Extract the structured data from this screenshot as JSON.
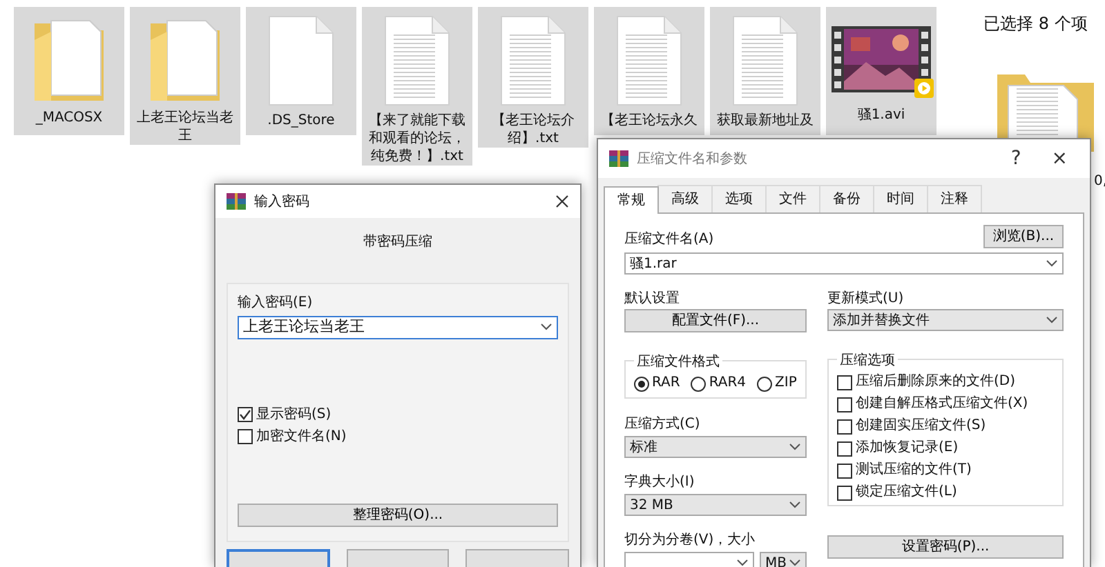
{
  "explorer": {
    "files": [
      {
        "name": "_MACOSX",
        "kind": "folder",
        "selected": true
      },
      {
        "name": "上老王论坛当老王",
        "kind": "folder",
        "selected": true
      },
      {
        "name": ".DS_Store",
        "kind": "blank",
        "selected": true
      },
      {
        "name": "【来了就能下载和观看的论坛，纯免费！】.txt",
        "kind": "text",
        "selected": true
      },
      {
        "name": "【老王论坛介绍】.txt",
        "kind": "text",
        "selected": true
      },
      {
        "name": "【老王论坛永久",
        "kind": "text",
        "selected": true
      },
      {
        "name": "获取最新地址及",
        "kind": "text",
        "selected": true
      },
      {
        "name": "骚1.avi",
        "kind": "video",
        "selected": true
      }
    ],
    "selection_status": "已选择 8 个项",
    "edge_text": "0,"
  },
  "password_dialog": {
    "title": "输入密码",
    "heading": "带密码压缩",
    "password_label": "输入密码(E)",
    "password_value": "上老王论坛当老王",
    "options": [
      {
        "label": "显示密码(S)",
        "checked": true
      },
      {
        "label": "加密文件名(N)",
        "checked": false
      }
    ],
    "organize_button": "整理密码(O)..."
  },
  "archive_dialog": {
    "title": "压缩文件名和参数",
    "help": "?",
    "close": "×",
    "tabs": [
      {
        "label": "常规",
        "selected": true
      },
      {
        "label": "高级",
        "selected": false
      },
      {
        "label": "选项",
        "selected": false
      },
      {
        "label": "文件",
        "selected": false
      },
      {
        "label": "备份",
        "selected": false
      },
      {
        "label": "时间",
        "selected": false
      },
      {
        "label": "注释",
        "selected": false
      }
    ],
    "archive_name_label": "压缩文件名(A)",
    "browse_button": "浏览(B)...",
    "archive_name": "骚1.rar",
    "profile_label": "默认设置",
    "profile_button": "配置文件(F)...",
    "update_mode_label": "更新模式(U)",
    "update_mode": "添加并替换文件",
    "format_group": "压缩文件格式",
    "formats": [
      {
        "label": "RAR",
        "selected": true
      },
      {
        "label": "RAR4",
        "selected": false
      },
      {
        "label": "ZIP",
        "selected": false
      }
    ],
    "method_label": "压缩方式(C)",
    "method": "标准",
    "dictionary_label": "字典大小(I)",
    "dictionary": "32 MB",
    "split_label": "切分为分卷(V)，大小",
    "split_unit": "MB",
    "options_group": "压缩选项",
    "options": [
      {
        "label": "压缩后删除原来的文件(D)",
        "checked": false
      },
      {
        "label": "创建自解压格式压缩文件(X)",
        "checked": false
      },
      {
        "label": "创建固实压缩文件(S)",
        "checked": false
      },
      {
        "label": "添加恢复记录(E)",
        "checked": false
      },
      {
        "label": "测试压缩的文件(T)",
        "checked": false
      },
      {
        "label": "锁定压缩文件(L)",
        "checked": false
      }
    ],
    "password_button": "设置密码(P)..."
  }
}
